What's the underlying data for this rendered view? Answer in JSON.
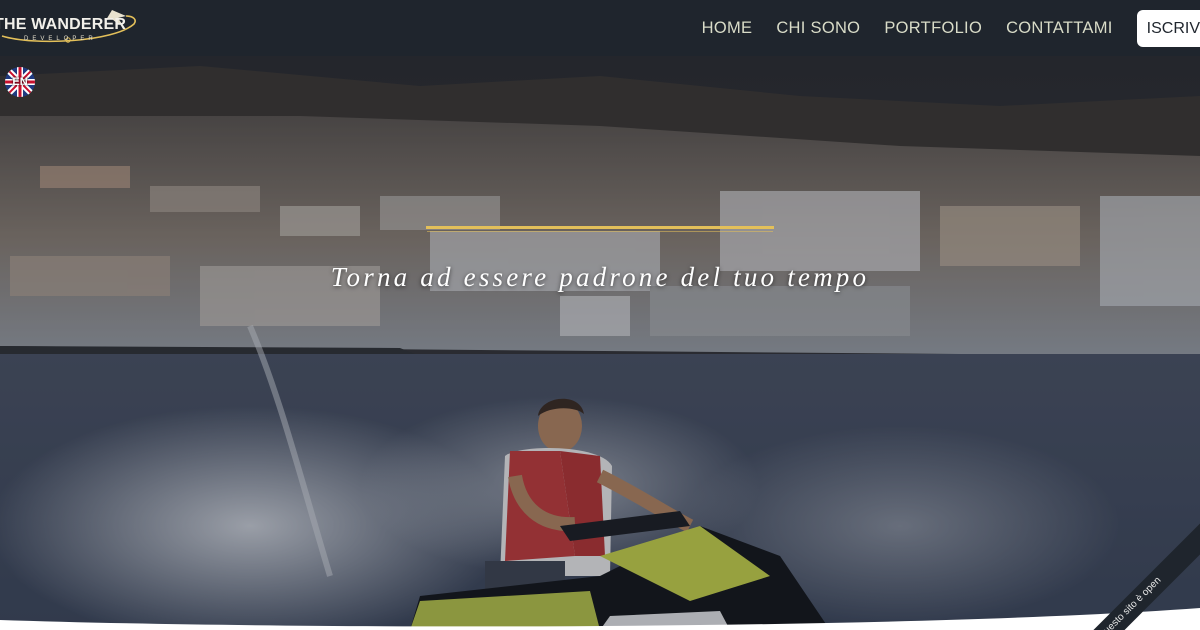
{
  "header": {
    "logo": {
      "title": "THE WANDERER",
      "subtitle": "DEVELOPER"
    },
    "nav": {
      "items": [
        {
          "label": "HOME"
        },
        {
          "label": "CHI SONO"
        },
        {
          "label": "PORTFOLIO"
        },
        {
          "label": "CONTATTAMI"
        }
      ],
      "cta_label": "ISCRIV"
    }
  },
  "hero": {
    "tagline": "Torna ad essere padrone del tuo tempo",
    "language_switch": {
      "label": "EN",
      "icon": "uk-flag-icon"
    },
    "corner_notice": "Questo sito è open"
  },
  "colors": {
    "header_bg": "#1f252d",
    "nav_text": "#d9dcc8",
    "accent_gold": "#e3c05a",
    "cta_bg": "#ffffff"
  }
}
